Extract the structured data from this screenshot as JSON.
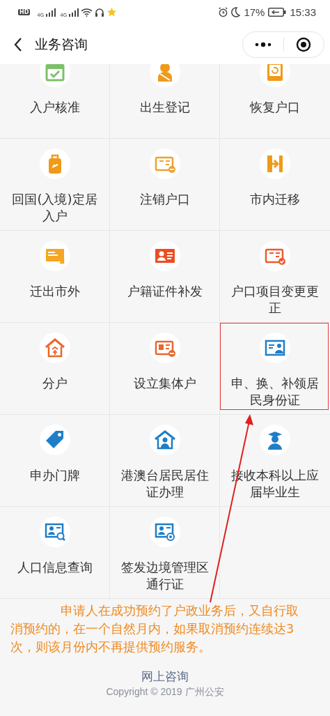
{
  "status_bar": {
    "left_badges": [
      "HD",
      "4G",
      "4G"
    ],
    "battery": "17%",
    "time": "15:33"
  },
  "nav": {
    "title": "业务咨询"
  },
  "items": [
    {
      "label": "入户核准",
      "color": "#7cc06a",
      "highlighted": false
    },
    {
      "label": "出生登记",
      "color": "#f09a1a",
      "highlighted": false
    },
    {
      "label": "恢复户口",
      "color": "#f09a1a",
      "highlighted": false
    },
    {
      "label": "回国(入境)定居入户",
      "color": "#f09a1a",
      "highlighted": false
    },
    {
      "label": "注销户口",
      "color": "#f0a030",
      "highlighted": false
    },
    {
      "label": "市内迁移",
      "color": "#f09a1a",
      "highlighted": false
    },
    {
      "label": "迁出市外",
      "color": "#f5a623",
      "highlighted": false
    },
    {
      "label": "户籍证件补发",
      "color": "#ec4e20",
      "highlighted": false
    },
    {
      "label": "户口项目变更更正",
      "color": "#ec5a30",
      "highlighted": false
    },
    {
      "label": "分户",
      "color": "#e8682e",
      "highlighted": false
    },
    {
      "label": "设立集体户",
      "color": "#e8682e",
      "highlighted": false
    },
    {
      "label": "申、换、补领居民身份证",
      "color": "#1e7ec8",
      "highlighted": true
    },
    {
      "label": "申办门牌",
      "color": "#1e7ec8",
      "highlighted": false
    },
    {
      "label": "港澳台居民居住证办理",
      "color": "#1e7ec8",
      "highlighted": false
    },
    {
      "label": "接收本科以上应届毕业生",
      "color": "#1e7ec8",
      "highlighted": false
    },
    {
      "label": "人口信息查询",
      "color": "#1e7ec8",
      "highlighted": false
    },
    {
      "label": "签发边境管理区通行证",
      "color": "#1e7ec8",
      "highlighted": false
    }
  ],
  "notice": "申请人在成功预约了户政业务后，又自行取消预约的，在一个自然月内，如果取消预约连续达3次，则该月份内不再提供预约服务。",
  "footer": {
    "link": "网上咨询",
    "copyright": "Copyright © 2019 广州公安"
  }
}
